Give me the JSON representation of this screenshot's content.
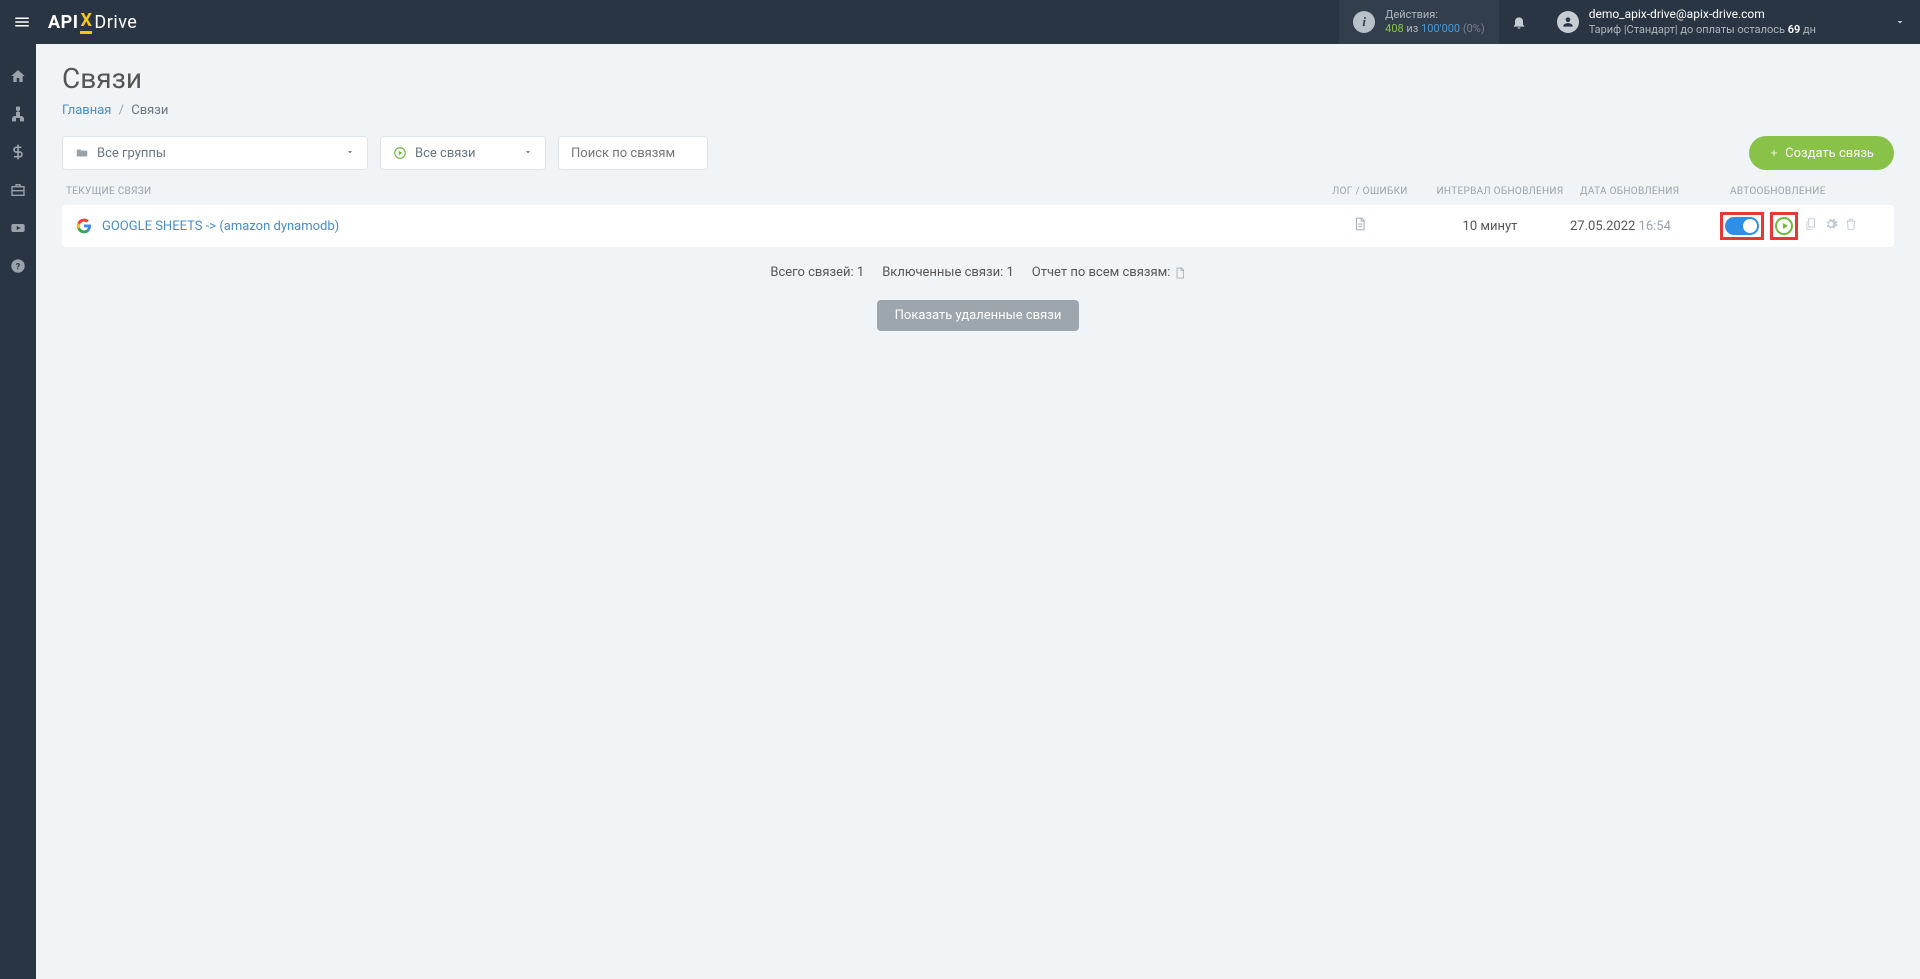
{
  "header": {
    "logo": {
      "api": "API",
      "x": "X",
      "drive": "Drive"
    },
    "actions": {
      "label": "Действия:",
      "used": "408",
      "of_word": "из",
      "limit": "100'000",
      "pct": "(0%)"
    },
    "user": {
      "email": "demo_apix-drive@apix-drive.com",
      "tariff_prefix": "Тариф |Стандарт| до оплаты осталось ",
      "tariff_days": "69",
      "tariff_suffix": " дн"
    }
  },
  "page": {
    "title": "Связи",
    "breadcrumb_home": "Главная",
    "breadcrumb_current": "Связи"
  },
  "toolbar": {
    "groups_label": "Все группы",
    "links_label": "Все связи",
    "search_placeholder": "Поиск по связям",
    "create_label": "Создать связь"
  },
  "columns": {
    "name": "ТЕКУЩИЕ СВЯЗИ",
    "log": "ЛОГ / ОШИБКИ",
    "interval": "ИНТЕРВАЛ ОБНОВЛЕНИЯ",
    "date": "ДАТА ОБНОВЛЕНИЯ",
    "auto": "АВТООБНОВЛЕНИЕ"
  },
  "row": {
    "name": "GOOGLE SHEETS -> (amazon dynamodb)",
    "interval": "10 минут",
    "date": "27.05.2022",
    "time": "16:54"
  },
  "summary": {
    "total_label": "Всего связей: ",
    "total_val": "1",
    "enabled_label": "Включенные связи: ",
    "enabled_val": "1",
    "report_label": "Отчет по всем связям:"
  },
  "show_deleted": "Показать удаленные связи"
}
